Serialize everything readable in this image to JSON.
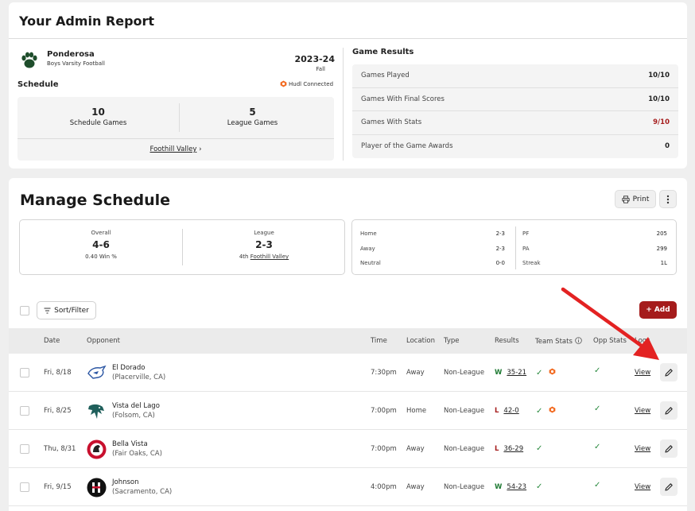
{
  "admin": {
    "title": "Your Admin Report",
    "team_name": "Ponderosa",
    "team_sub": "Boys Varsity Football",
    "season_year": "2023-24",
    "season_term": "Fall",
    "schedule_label": "Schedule",
    "hudl_label": "Hudl Connected",
    "schedule_games_count": "10",
    "schedule_games_label": "Schedule Games",
    "league_games_count": "5",
    "league_games_label": "League Games",
    "league_link": "Foothill Valley",
    "results_title": "Game Results",
    "results": [
      {
        "label": "Games Played",
        "value": "10/10"
      },
      {
        "label": "Games With Final Scores",
        "value": "10/10"
      },
      {
        "label": "Games With Stats",
        "value": "9/10"
      },
      {
        "label": "Player of the Game Awards",
        "value": "0"
      }
    ]
  },
  "manage": {
    "title": "Manage Schedule",
    "print_label": "Print",
    "overall_label": "Overall",
    "overall_record": "4-6",
    "win_pct": "0.40",
    "win_pct_label": "Win %",
    "league_label": "League",
    "league_record": "2-3",
    "league_rank": "4th",
    "league_name": "Foothill Valley",
    "splits_left": [
      {
        "label": "Home",
        "value": "2-3"
      },
      {
        "label": "Away",
        "value": "2-3"
      },
      {
        "label": "Neutral",
        "value": "0-0"
      }
    ],
    "splits_right": [
      {
        "label": "PF",
        "value": "205"
      },
      {
        "label": "PA",
        "value": "299"
      },
      {
        "label": "Streak",
        "value": "1L"
      }
    ],
    "sort_label": "Sort/Filter",
    "add_label": "Add",
    "columns": {
      "date": "Date",
      "opponent": "Opponent",
      "time": "Time",
      "location": "Location",
      "type": "Type",
      "results": "Results",
      "team_stats": "Team Stats",
      "opp_stats": "Opp Stats",
      "logs": "Logs"
    },
    "games": [
      {
        "date": "Fri, 8/18",
        "opponent": "El Dorado",
        "opp_loc": "(Placerville, CA)",
        "time": "7:30pm",
        "location": "Away",
        "type": "Non-League",
        "wl": "W",
        "score": "35-21",
        "view": "View"
      },
      {
        "date": "Fri, 8/25",
        "opponent": "Vista del Lago",
        "opp_loc": "(Folsom, CA)",
        "time": "7:00pm",
        "location": "Home",
        "type": "Non-League",
        "wl": "L",
        "score": "42-0",
        "view": "View"
      },
      {
        "date": "Thu, 8/31",
        "opponent": "Bella Vista",
        "opp_loc": "(Fair Oaks, CA)",
        "time": "7:00pm",
        "location": "Away",
        "type": "Non-League",
        "wl": "L",
        "score": "36-29",
        "view": "View"
      },
      {
        "date": "Fri, 9/15",
        "opponent": "Johnson",
        "opp_loc": "(Sacramento, CA)",
        "time": "4:00pm",
        "location": "Away",
        "type": "Non-League",
        "wl": "W",
        "score": "54-23",
        "view": "View"
      }
    ]
  },
  "colors": {
    "accent_red": "#a51c1c",
    "win_green": "#1e7a33",
    "hudl_orange": "#f26b21"
  }
}
